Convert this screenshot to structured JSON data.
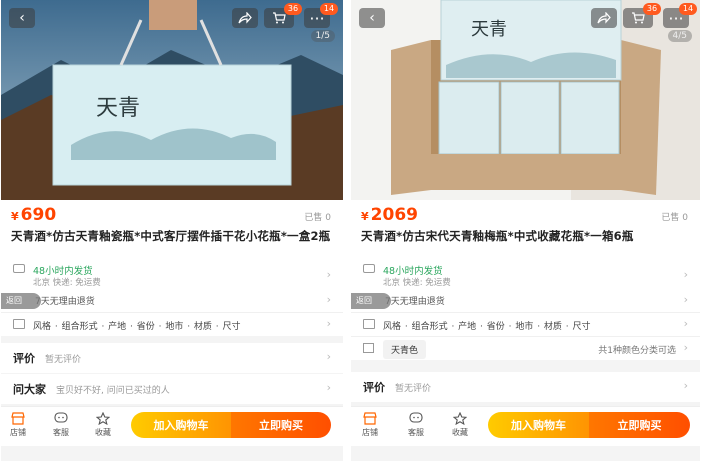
{
  "left": {
    "pager": "1/5",
    "cart_badge": "36",
    "more_badge": "14",
    "price_symbol": "¥",
    "price": "690",
    "sold": "已售 0",
    "title": "天青酒*仿古天青釉瓷瓶*中式客厅摆件插干花小花瓶*一盒2瓶",
    "ship_line1": "48小时内发货",
    "ship_line2": "北京 快递: 免运费",
    "return_text": "7天无理由退货",
    "float_back": "返回",
    "spec_text": "风格 · 组合形式 · 产地 · 省份 · 地市 · 材质 · 尺寸",
    "review_heading": "评价",
    "review_sub": "暂无评价",
    "qa_heading": "问大家",
    "qa_sub": "宝贝好不好, 问问已买过的人",
    "bag_brand": "天青"
  },
  "right": {
    "pager": "4/5",
    "cart_badge": "36",
    "more_badge": "14",
    "price_symbol": "¥",
    "price": "2069",
    "sold": "已售 0",
    "title": "天青酒*仿古宋代天青釉梅瓶*中式收藏花瓶*一箱6瓶",
    "ship_line1": "48小时内发货",
    "ship_line2": "北京 快递: 免运费",
    "return_text": "7天无理由退货",
    "float_back": "返回",
    "spec_text": "风格 · 组合形式 · 产地 · 省份 · 地市 · 材质 · 尺寸",
    "color_chip": "天青色",
    "color_note": "共1种颜色分类可选",
    "review_heading": "评价",
    "review_sub": "暂无评价",
    "box_brand": "天青"
  },
  "tabbar": {
    "store": "店铺",
    "service": "客服",
    "favorite": "收藏",
    "add_cart": "加入购物车",
    "buy_now": "立即购买"
  },
  "icons": [
    "back-icon",
    "share-icon",
    "cart-icon",
    "more-icon",
    "truck-icon",
    "return-icon",
    "spec-icon",
    "color-icon",
    "store-icon",
    "service-icon",
    "star-icon",
    "chevron-right-icon"
  ],
  "colors": {
    "accent": "#ff4400",
    "ship_green": "#2aa65d",
    "cart_btn": "#ffb300",
    "buy_btn": "#ff5a00"
  }
}
